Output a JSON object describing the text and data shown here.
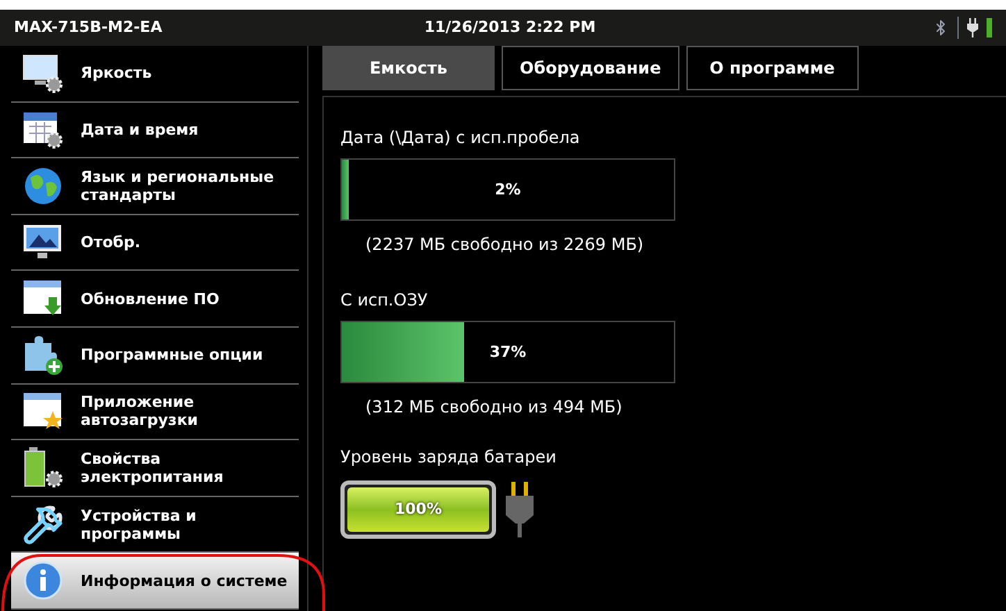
{
  "status_bar": {
    "device": "MAX-715B-M2-EA",
    "datetime": "11/26/2013 2:22 PM",
    "bluetooth": true,
    "charging": true
  },
  "sidebar": {
    "items": [
      {
        "label": "Яркость",
        "selected": false
      },
      {
        "label": "Дата и время",
        "selected": false
      },
      {
        "label": "Язык и региональные стандарты",
        "selected": false
      },
      {
        "label": "Отобр.",
        "selected": false
      },
      {
        "label": "Обновление ПО",
        "selected": false
      },
      {
        "label": "Программные опции",
        "selected": false
      },
      {
        "label": "Приложение автозагрузки",
        "selected": false
      },
      {
        "label": "Свойства электропитания",
        "selected": false
      },
      {
        "label": "Устройства и программы",
        "selected": false
      },
      {
        "label": "Информация о системе",
        "selected": true
      }
    ]
  },
  "tabs": [
    {
      "label": "Емкость",
      "selected": true
    },
    {
      "label": "Оборудование",
      "selected": false
    },
    {
      "label": "О программе",
      "selected": false
    }
  ],
  "meters": [
    {
      "label": "Дата (\\Дата) с исп.пробела",
      "level": 0.02,
      "reading": "2%",
      "detail": "(2237 МБ свободно из 2269 МБ)"
    },
    {
      "label": "С исп.ОЗУ",
      "level": 0.37,
      "reading": "37%",
      "detail": "(312 МБ свободно из 494 МБ)"
    }
  ],
  "battery": {
    "label": "Уровень заряда батареи",
    "level": 1,
    "reading": "100%",
    "charging": true
  }
}
